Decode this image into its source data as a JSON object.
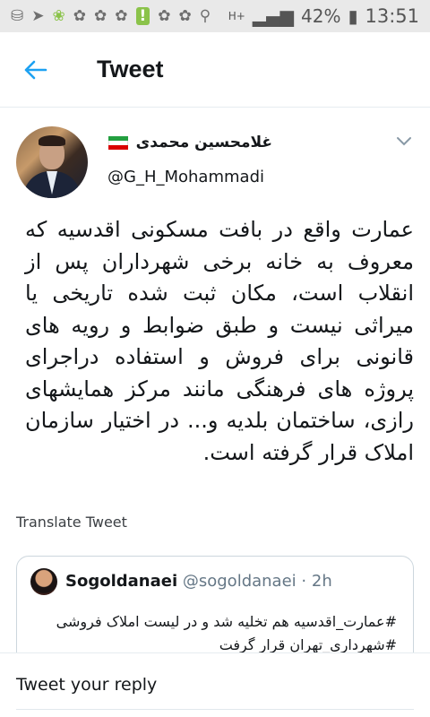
{
  "status_bar": {
    "battery_percent": "42%",
    "time": "13:51",
    "network": "H+"
  },
  "app_bar": {
    "title": "Tweet"
  },
  "tweet": {
    "display_name": "غلامحسین محمدی",
    "handle": "@G_H_Mohammadi",
    "text": "عمارت واقع در بافت مسکونی اقدسیه که معروف به خانه برخی شهرداران پس از انقلاب است، مکان ثبت شده تاریخی یا میراثی نیست و طبق ضوابط و رویه های قانونی برای فروش و استفاده دراجرای پروژه های فرهنگی مانند مرکز همایشهای رازی، ساختمان بلدیه و...  در اختیار سازمان املاک قرار گرفته است.",
    "translate_label": "Translate Tweet"
  },
  "quoted_tweet": {
    "name": "Sogoldanaei",
    "handle": "@sogoldanaei",
    "separator": "·",
    "time": "2h",
    "text_line1": "#عمارت_اقدسیه هم تخلیه شد و در لیست املاک فروشی",
    "text_line2": "#شهرداری_تهران قرار گرفت"
  },
  "reply": {
    "placeholder": "Tweet your reply"
  },
  "colors": {
    "accent": "#1da1f2",
    "text": "#14171a",
    "secondary": "#657786"
  }
}
